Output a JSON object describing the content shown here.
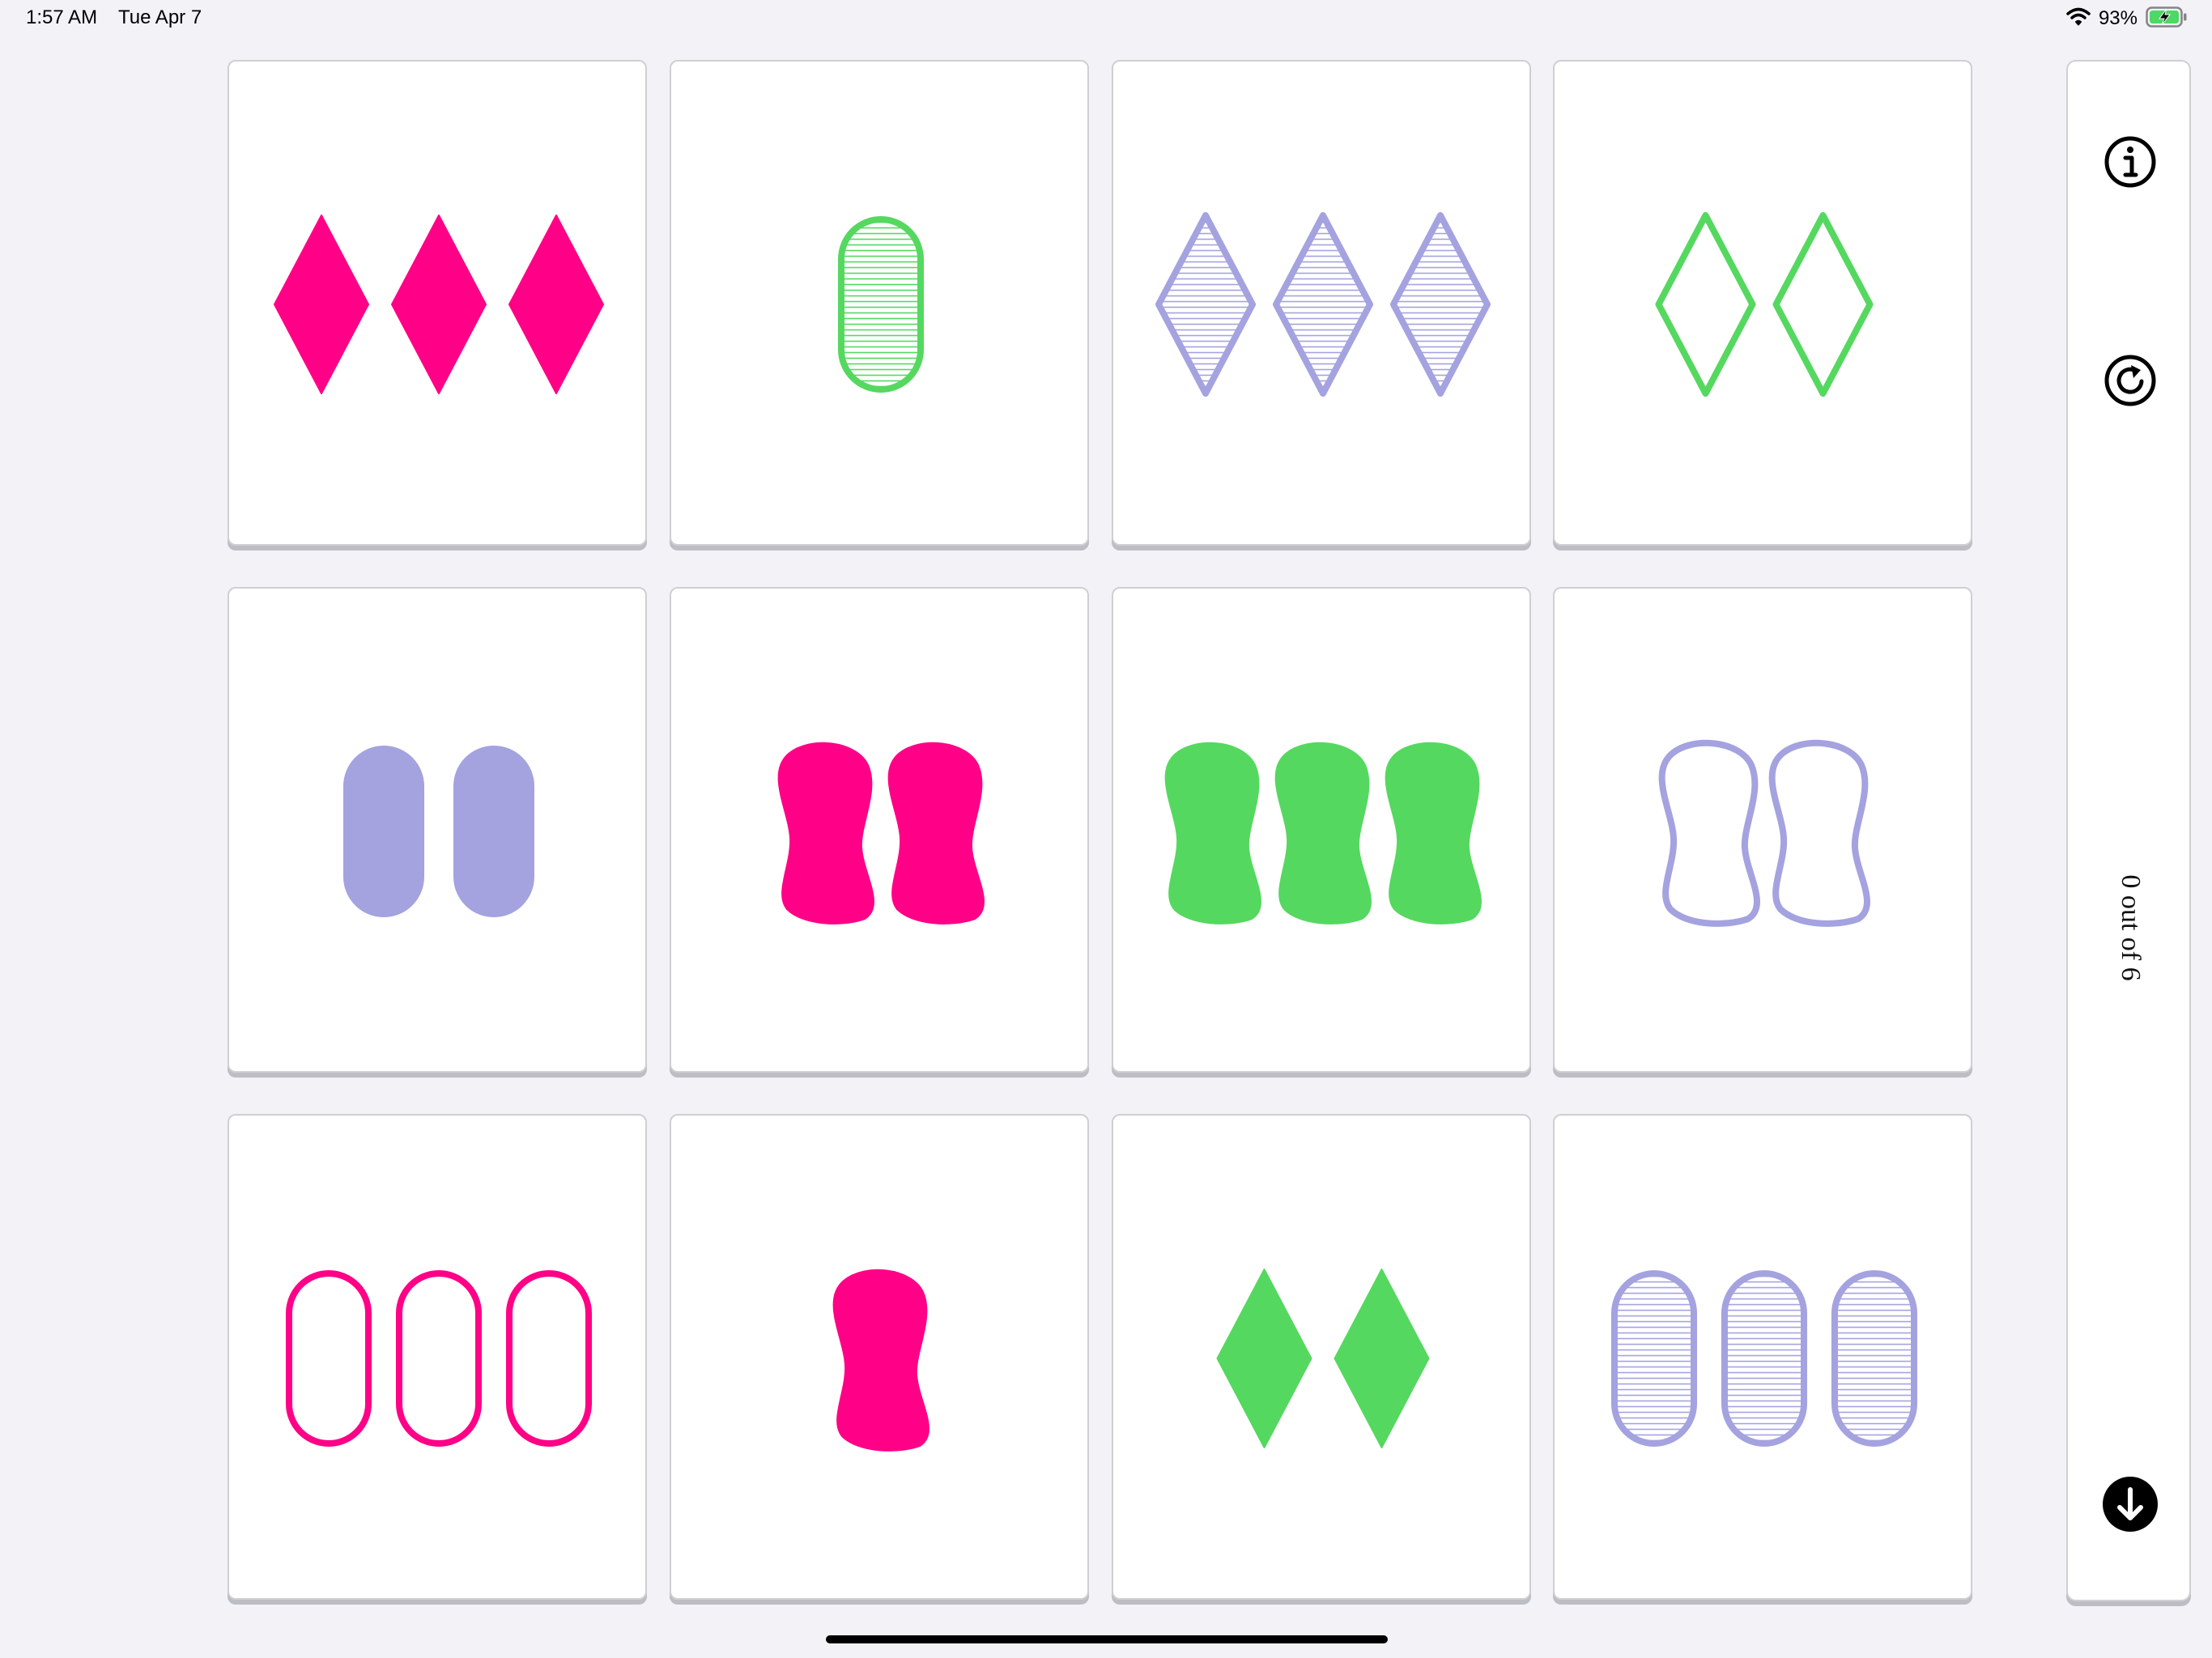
{
  "status_bar": {
    "time": "1:57 AM",
    "date": "Tue Apr 7",
    "battery_percent": "93%",
    "icons": [
      "wifi-icon",
      "battery-charging-icon"
    ]
  },
  "colors": {
    "pink": "#ff0087",
    "green": "#55d85f",
    "purple": "#a5a2e0"
  },
  "cards": [
    {
      "count": 3,
      "shape": "diamond",
      "color": "pink",
      "fill": "solid"
    },
    {
      "count": 1,
      "shape": "oval",
      "color": "green",
      "fill": "striped"
    },
    {
      "count": 3,
      "shape": "diamond",
      "color": "purple",
      "fill": "striped"
    },
    {
      "count": 2,
      "shape": "diamond",
      "color": "green",
      "fill": "open"
    },
    {
      "count": 2,
      "shape": "oval",
      "color": "purple",
      "fill": "solid"
    },
    {
      "count": 2,
      "shape": "squiggle",
      "color": "pink",
      "fill": "solid"
    },
    {
      "count": 3,
      "shape": "squiggle",
      "color": "green",
      "fill": "solid"
    },
    {
      "count": 2,
      "shape": "squiggle",
      "color": "purple",
      "fill": "open"
    },
    {
      "count": 3,
      "shape": "oval",
      "color": "pink",
      "fill": "open"
    },
    {
      "count": 1,
      "shape": "squiggle",
      "color": "pink",
      "fill": "solid"
    },
    {
      "count": 2,
      "shape": "diamond",
      "color": "green",
      "fill": "solid"
    },
    {
      "count": 3,
      "shape": "oval",
      "color": "purple",
      "fill": "striped"
    }
  ],
  "sidebar": {
    "info_icon": "info-icon",
    "restart_icon": "restart-icon",
    "score_text": "0 out of 6",
    "deal_icon": "arrow-down-icon"
  }
}
